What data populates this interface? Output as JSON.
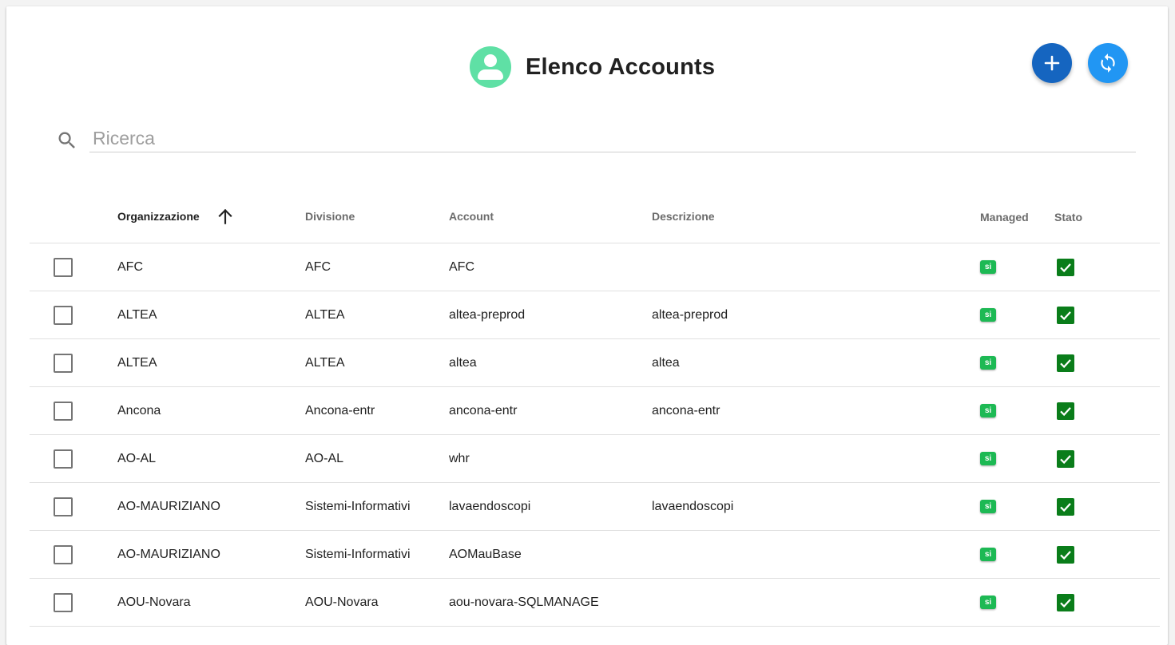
{
  "header": {
    "title": "Elenco Accounts",
    "icon": "account-circle-icon",
    "add_icon": "plus-icon",
    "refresh_icon": "refresh-icon",
    "colors": {
      "add_button": "#1565c0",
      "refresh_button": "#2196f3",
      "avatar": "#5fe0a5"
    }
  },
  "search": {
    "placeholder": "Ricerca",
    "value": ""
  },
  "table": {
    "columns": {
      "organizzazione": "Organizzazione",
      "divisione": "Divisione",
      "account": "Account",
      "descrizione": "Descrizione",
      "managed": "Managed",
      "stato": "Stato"
    },
    "sort": {
      "column": "Organizzazione",
      "direction": "ascending"
    },
    "rows": [
      {
        "organizzazione": "AFC",
        "divisione": "AFC",
        "account": "AFC",
        "descrizione": "",
        "managed": "si",
        "stato": true
      },
      {
        "organizzazione": "ALTEA",
        "divisione": "ALTEA",
        "account": "altea-preprod",
        "descrizione": "altea-preprod",
        "managed": "si",
        "stato": true
      },
      {
        "organizzazione": "ALTEA",
        "divisione": "ALTEA",
        "account": "altea",
        "descrizione": "altea",
        "managed": "si",
        "stato": true
      },
      {
        "organizzazione": "Ancona",
        "divisione": "Ancona-entr",
        "account": "ancona-entr",
        "descrizione": "ancona-entr",
        "managed": "si",
        "stato": true
      },
      {
        "organizzazione": "AO-AL",
        "divisione": "AO-AL",
        "account": "whr",
        "descrizione": "",
        "managed": "si",
        "stato": true
      },
      {
        "organizzazione": "AO-MAURIZIANO",
        "divisione": "Sistemi-Informativi",
        "account": "lavaendoscopi",
        "descrizione": "lavaendoscopi",
        "managed": "si",
        "stato": true
      },
      {
        "organizzazione": "AO-MAURIZIANO",
        "divisione": "Sistemi-Informativi",
        "account": "AOMauBase",
        "descrizione": "",
        "managed": "si",
        "stato": true
      },
      {
        "organizzazione": "AOU-Novara",
        "divisione": "AOU-Novara",
        "account": "aou-novara-SQLMANAGE",
        "descrizione": "",
        "managed": "si",
        "stato": true
      }
    ]
  }
}
